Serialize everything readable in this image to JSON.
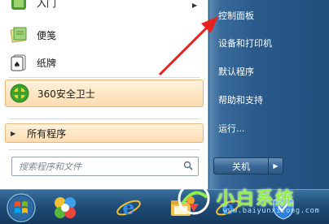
{
  "left_pane": {
    "pinned_items": [
      {
        "label": "入门",
        "icon": "getting-started-icon"
      },
      {
        "label": "便笺",
        "icon": "sticky-notes-icon"
      },
      {
        "label": "纸牌",
        "icon": "solitaire-icon"
      },
      {
        "label": "360安全卫士",
        "icon": "360-safe-guard-icon"
      }
    ],
    "all_programs": "所有程序",
    "search": {
      "placeholder": "搜索程序和文件"
    }
  },
  "right_pane": {
    "items": [
      "控制面板",
      "设备和打印机",
      "默认程序",
      "帮助和支持",
      "运行..."
    ],
    "shutdown_label": "关机"
  },
  "taskbar": {
    "buttons": [
      "start-orb",
      "360-browser",
      "internet-explorer",
      "file-explorer",
      "ie-pinned",
      "shield-app"
    ]
  },
  "watermark": {
    "title": "小白系统",
    "url": "www.baiyunxitong.com"
  },
  "colors": {
    "highlight": "#fcdcae",
    "right_pane": "#2a5a8a",
    "taskbar": "#204e78",
    "arrow": "#e8231f",
    "watermark": "#8ff04a"
  }
}
